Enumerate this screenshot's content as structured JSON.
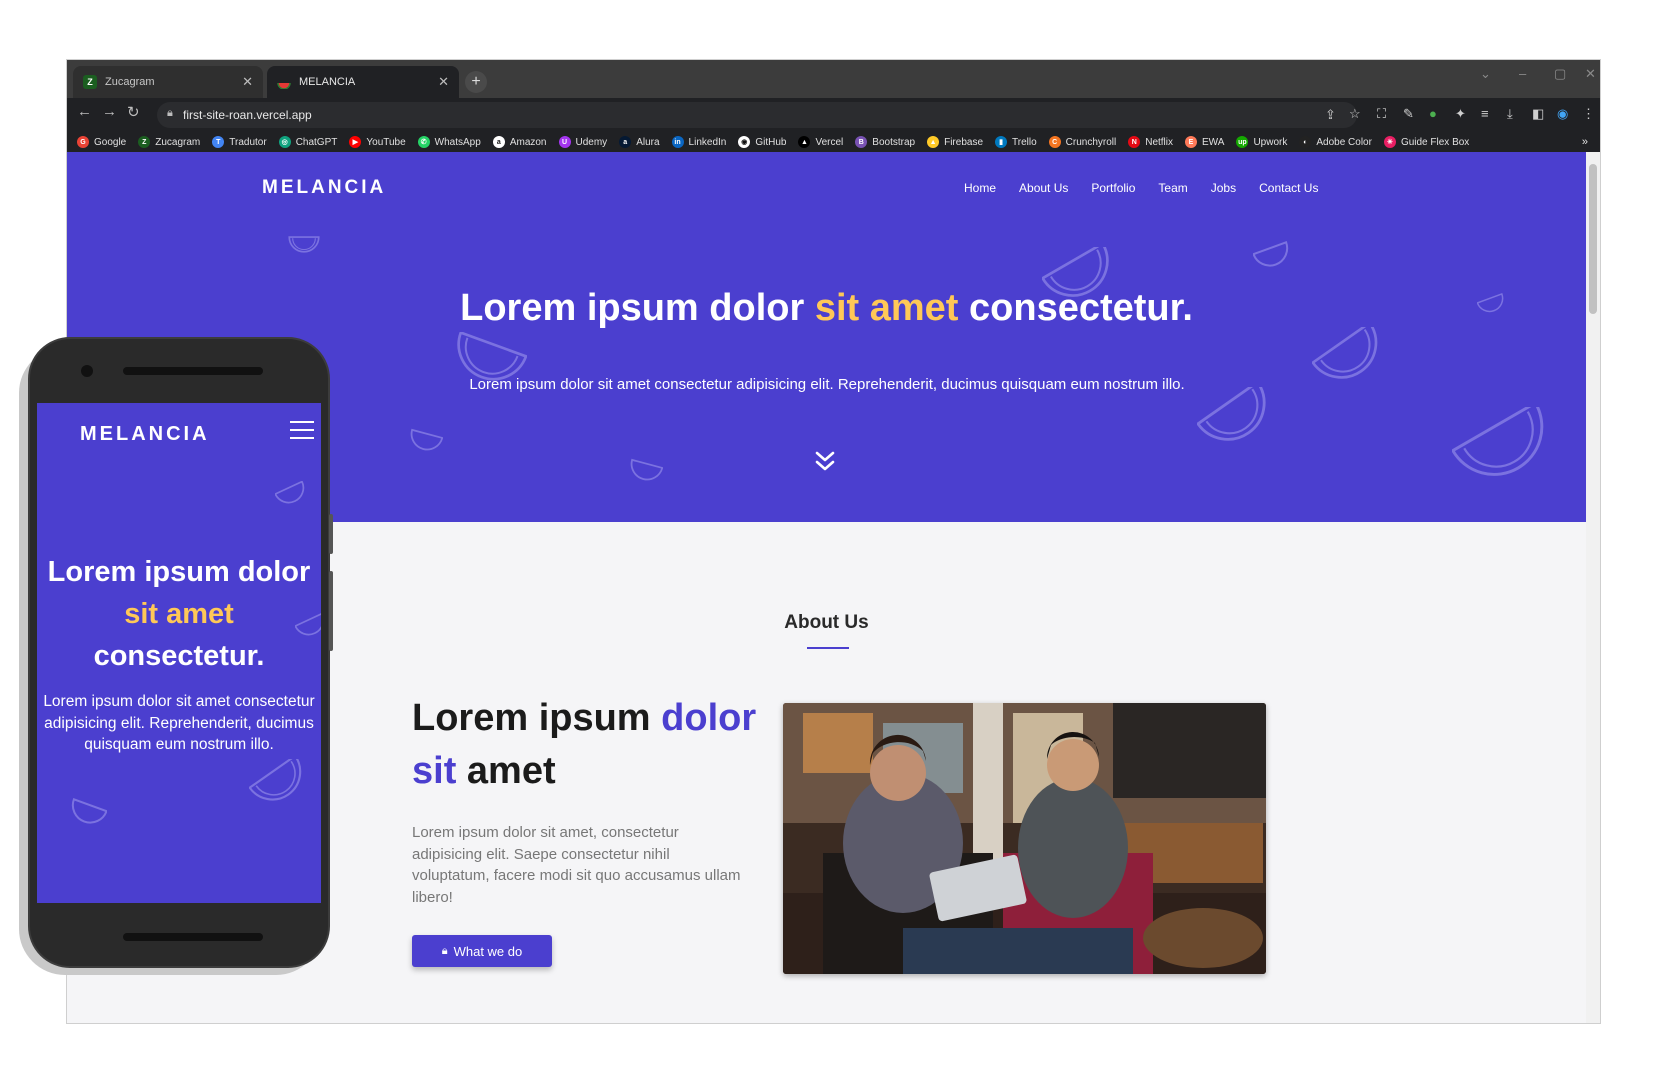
{
  "browser": {
    "tabs": [
      {
        "title": "Zucagram",
        "active": false
      },
      {
        "title": "MELANCIA",
        "active": true
      }
    ],
    "new_tab": "+",
    "url": "first-site-roan.vercel.app",
    "bookmarks": [
      {
        "label": "Google",
        "color": "#ea4335",
        "glyph": "G"
      },
      {
        "label": "Zucagram",
        "color": "#1b5e20",
        "glyph": "Z"
      },
      {
        "label": "Tradutor",
        "color": "#4285f4",
        "glyph": "T"
      },
      {
        "label": "ChatGPT",
        "color": "#10a37f",
        "glyph": "◎"
      },
      {
        "label": "YouTube",
        "color": "#ff0000",
        "glyph": "▶"
      },
      {
        "label": "WhatsApp",
        "color": "#25d366",
        "glyph": "✆"
      },
      {
        "label": "Amazon",
        "color": "#ffffff",
        "glyph": "a"
      },
      {
        "label": "Udemy",
        "color": "#a435f0",
        "glyph": "U"
      },
      {
        "label": "Alura",
        "color": "#051933",
        "glyph": "a"
      },
      {
        "label": "LinkedIn",
        "color": "#0a66c2",
        "glyph": "in"
      },
      {
        "label": "GitHub",
        "color": "#ffffff",
        "glyph": "◉"
      },
      {
        "label": "Vercel",
        "color": "#000000",
        "glyph": "▲"
      },
      {
        "label": "Bootstrap",
        "color": "#7952b3",
        "glyph": "B"
      },
      {
        "label": "Firebase",
        "color": "#ffca28",
        "glyph": "▲"
      },
      {
        "label": "Trello",
        "color": "#0079bf",
        "glyph": "▮"
      },
      {
        "label": "Crunchyroll",
        "color": "#f47521",
        "glyph": "C"
      },
      {
        "label": "Netflix",
        "color": "#e50914",
        "glyph": "N"
      },
      {
        "label": "EWA",
        "color": "#ff7a59",
        "glyph": "E"
      },
      {
        "label": "Upwork",
        "color": "#14a800",
        "glyph": "up"
      },
      {
        "label": "Adobe Color",
        "color": "#222222",
        "glyph": "◐"
      },
      {
        "label": "Guide Flex Box",
        "color": "#e91e63",
        "glyph": "✳"
      }
    ],
    "more": "»"
  },
  "site": {
    "logo": "MELANCIA",
    "nav": [
      "Home",
      "About Us",
      "Portfolio",
      "Team",
      "Jobs",
      "Contact Us"
    ],
    "hero": {
      "title_pre": "Lorem ipsum dolor ",
      "title_highlight": "sit amet",
      "title_post": " consectetur.",
      "text": "Lorem ipsum dolor sit amet consectetur adipisicing elit. Reprehenderit, ducimus quisquam eum nostrum illo."
    },
    "about": {
      "heading_light": "About ",
      "heading_bold": "Us",
      "title_1": "Lorem ipsum ",
      "title_accent_1": "dolor",
      "title_accent_2": "sit",
      "title_2": " amet",
      "text": "Lorem ipsum dolor sit amet, consectetur adipisicing elit. Saepe consectetur nihil voluptatum, facere modi sit quo accusamus ullam libero!",
      "button_label": "What we do"
    }
  },
  "mobile": {
    "logo": "MELANCIA",
    "title_1": "Lorem ipsum dolor",
    "title_highlight": "sit amet",
    "title_2": "consectetur.",
    "text": "Lorem ipsum dolor sit amet consectetur adipisicing elit. Reprehenderit, ducimus quisquam eum nostrum illo."
  },
  "colors": {
    "brand_purple": "#4b3fcf",
    "highlight_yellow": "#ffc857",
    "page_bg": "#f5f5f7"
  }
}
